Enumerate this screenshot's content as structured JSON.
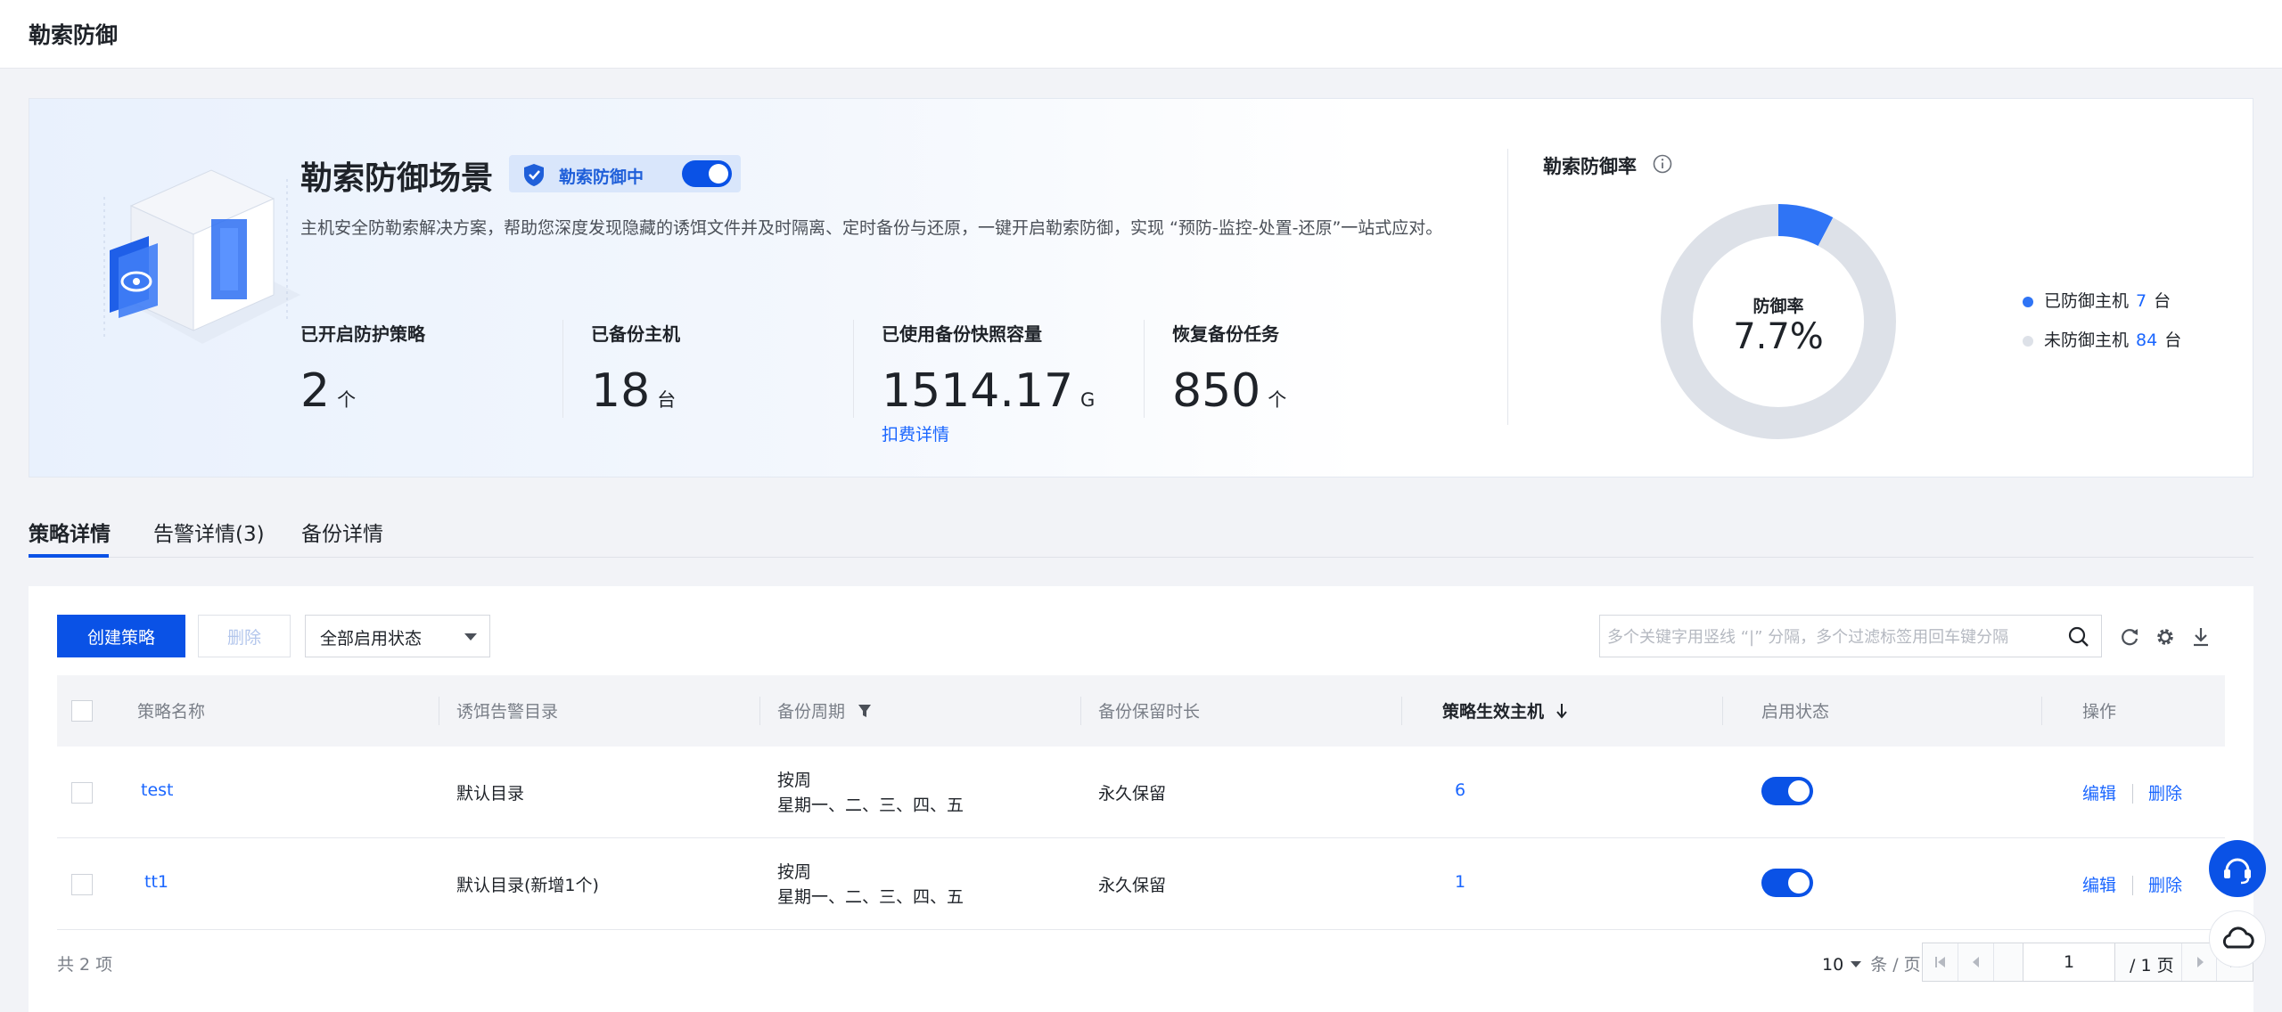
{
  "page_title": "勒索防御",
  "hero": {
    "title": "勒索防御场景",
    "badge_label": "勒索防御中",
    "description": "主机安全防勒索解决方案，帮助您深度发现隐藏的诱饵文件并及时隔离、定时备份与还原，一键开启勒索防御，实现 “预防-监控-处置-还原”一站式应对。",
    "stats": [
      {
        "label": "已开启防护策略",
        "value": "2",
        "unit": "个"
      },
      {
        "label": "已备份主机",
        "value": "18",
        "unit": "台"
      },
      {
        "label": "已使用备份快照容量",
        "value": "1514.17",
        "unit": "G",
        "link": "扣费详情"
      },
      {
        "label": "恢复备份任务",
        "value": "850",
        "unit": "个"
      }
    ]
  },
  "rate": {
    "title": "勒索防御率",
    "center_label": "防御率",
    "center_value": "7.7%",
    "legend": [
      {
        "label": "已防御主机",
        "count": "7",
        "unit": "台",
        "color": "#2f74f5"
      },
      {
        "label": "未防御主机",
        "count": "84",
        "unit": "台",
        "color": "#dde1e8"
      }
    ],
    "chart_data": {
      "type": "pie",
      "categories": [
        "已防御主机",
        "未防御主机"
      ],
      "values": [
        7,
        84
      ]
    }
  },
  "tabs": [
    {
      "label": "策略详情",
      "active": true
    },
    {
      "label": "告警详情(3)",
      "active": false
    },
    {
      "label": "备份详情",
      "active": false
    }
  ],
  "toolbar": {
    "create_label": "创建策略",
    "delete_label": "删除",
    "status_filter": "全部启用状态",
    "search_placeholder": "多个关键字用竖线 “|” 分隔，多个过滤标签用回车键分隔"
  },
  "table": {
    "headers": [
      "策略名称",
      "诱饵告警目录",
      "备份周期",
      "备份保留时长",
      "策略生效主机",
      "启用状态",
      "操作"
    ],
    "rows": [
      {
        "name": "test",
        "dir": "默认目录",
        "cycle_a": "按周",
        "cycle_b": "星期一、二、三、四、五",
        "retention": "永久保留",
        "hosts": "6",
        "enabled": true,
        "edit": "编辑",
        "del": "删除"
      },
      {
        "name": "tt1",
        "dir": "默认目录(新增1个)",
        "cycle_a": "按周",
        "cycle_b": "星期一、二、三、四、五",
        "retention": "永久保留",
        "hosts": "1",
        "enabled": true,
        "edit": "编辑",
        "del": "删除"
      }
    ]
  },
  "footer": {
    "total": "共 2 项",
    "page_size": "10",
    "per_page": "条 / 页",
    "current_page": "1",
    "total_pages": "/ 1 页"
  },
  "colors": {
    "accent": "#0a52e6",
    "link": "#1a66ff"
  }
}
